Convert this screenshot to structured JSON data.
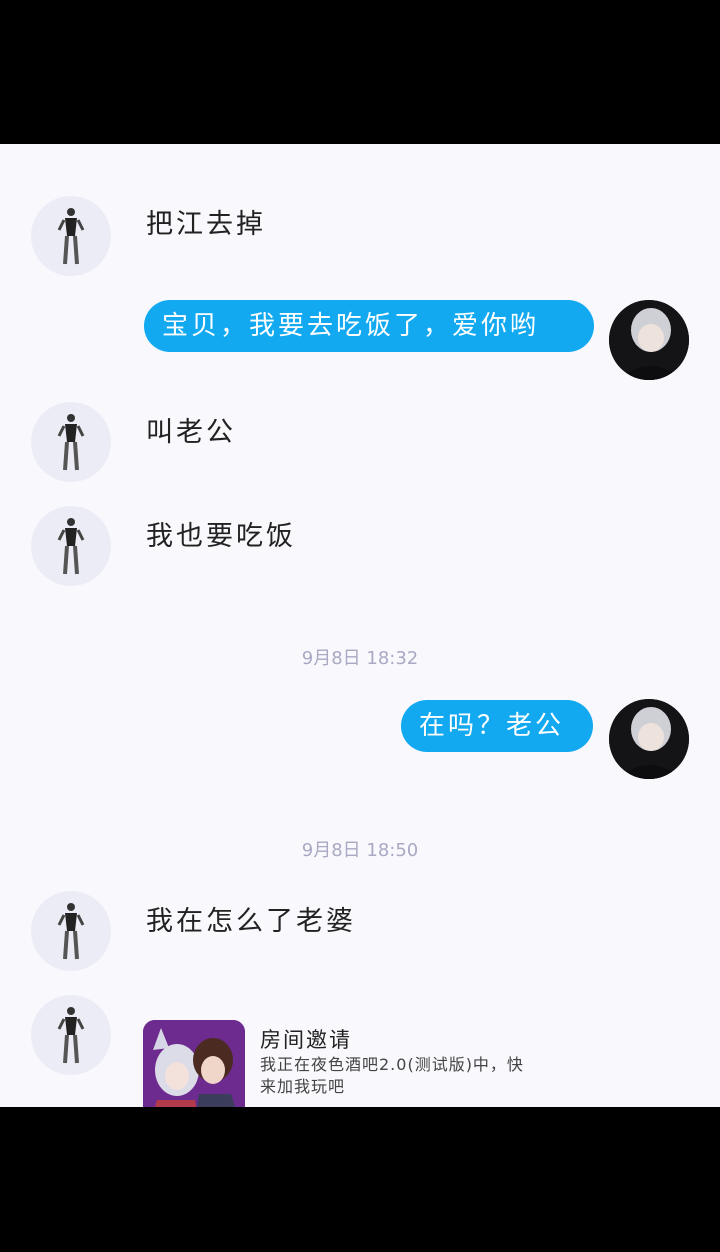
{
  "messages": [
    {
      "side": "left",
      "text": "把江去掉"
    },
    {
      "side": "right",
      "text": "宝贝，我要去吃饭了，爱你哟"
    },
    {
      "side": "left",
      "text": "叫老公"
    },
    {
      "side": "left",
      "text": "我也要吃饭"
    },
    {
      "side": "right",
      "text": "在吗？老公"
    },
    {
      "side": "left",
      "text": "我在怎么了老婆"
    }
  ],
  "timestamps": [
    "9月8日 18:32",
    "9月8日 18:50"
  ],
  "invite": {
    "title": "房间邀请",
    "description": "我正在夜色酒吧2.0(测试版)中，快来加我玩吧"
  },
  "colors": {
    "chat_background": "#f8f8fd",
    "outgoing_bubble": "#12a9f1",
    "timestamp_text": "#a9a9c4"
  }
}
